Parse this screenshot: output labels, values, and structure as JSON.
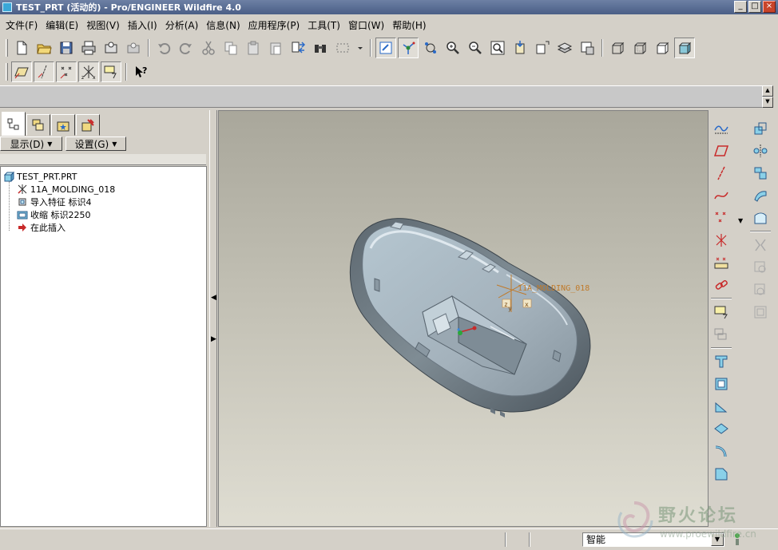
{
  "window": {
    "title": "TEST_PRT (活动的) - Pro/ENGINEER Wildfire 4.0",
    "minimize": "_",
    "maximize": "□",
    "close": "×"
  },
  "menu": [
    "文件(F)",
    "编辑(E)",
    "视图(V)",
    "插入(I)",
    "分析(A)",
    "信息(N)",
    "应用程序(P)",
    "工具(T)",
    "窗口(W)",
    "帮助(H)"
  ],
  "panel": {
    "tabs": [
      "model-tree-icon",
      "layer-icon",
      "favorites-icon",
      "connections-icon"
    ],
    "show_button": "显示(D)",
    "settings_button": "设置(G)"
  },
  "tree": [
    {
      "label": "TEST_PRT.PRT",
      "icon": "part-icon"
    },
    {
      "label": "11A_MOLDING_018",
      "icon": "csys-icon"
    },
    {
      "label": "导入特征 标识4",
      "icon": "import-feature-icon"
    },
    {
      "label": "收缩 标识2250",
      "icon": "shrink-icon"
    },
    {
      "label": "在此插入",
      "icon": "insert-here-arrow-icon"
    }
  ],
  "viewport": {
    "csys_label": "11A_MOLDING_018",
    "axis_x": "x",
    "axis_y": "y",
    "axis_z": "z"
  },
  "status": {
    "filter_value": "智能"
  },
  "watermark": {
    "text": "野火论坛",
    "url": "www.proewildfire.cn"
  },
  "colors": {
    "title_bar": "#5a6d94",
    "model_gray": "#9aa6ae",
    "viewport_top": "#a9a79b",
    "viewport_bottom": "#dfddd2",
    "csys_orange": "#c07a2a"
  }
}
